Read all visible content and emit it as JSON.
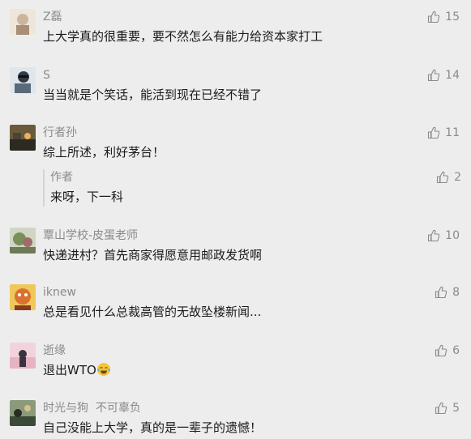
{
  "comments": [
    {
      "nickname": "Z磊",
      "text": "上大学真的很重要，要不然怎么有能力给资本家打工",
      "likes": "15",
      "avatar_color": "#d9c9b8"
    },
    {
      "nickname": "S",
      "text": "当当就是个笑话，能活到现在已经不错了",
      "likes": "14",
      "avatar_color": "#6a7a86"
    },
    {
      "nickname": "行者孙",
      "text": "综上所述，利好茅台！",
      "likes": "11",
      "avatar_color": "#3a3a30",
      "reply": {
        "nickname": "作者",
        "text": "来呀，下一科",
        "likes": "2"
      }
    },
    {
      "nickname": "覃山学校-皮蛋老师",
      "text": "快递进村？首先商家得愿意用邮政发货啊",
      "likes": "10",
      "avatar_color": "#7e8a6a"
    },
    {
      "nickname": "iknew",
      "text": "总是看见什么总裁高管的无故坠楼新闻...",
      "likes": "8",
      "avatar_color": "#c9562e"
    },
    {
      "nickname": "逝缘",
      "text_before_emoji": "退出WTO",
      "emoji": "laughing-tears",
      "likes": "6",
      "avatar_color": "#e7b3c3"
    },
    {
      "nickname": "时光与狗  不可辜负",
      "text": "自己没能上大学，真的是一辈子的遗憾！",
      "likes": "5",
      "avatar_color": "#4b5a4a"
    }
  ],
  "colors": {
    "background": "#ededed",
    "nickname": "#8a8a8a",
    "text": "#1a1a1a",
    "reply_border": "#d5d5d5"
  },
  "icons": {
    "like": "thumbs-up-icon"
  }
}
